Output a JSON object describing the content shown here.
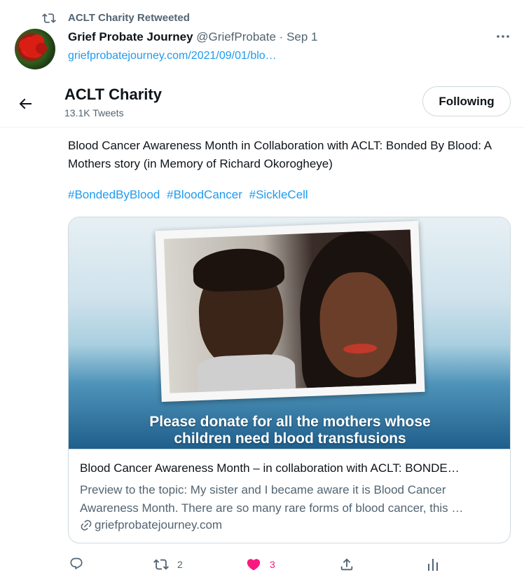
{
  "retweet_header": {
    "text": "ACLT Charity Retweeted"
  },
  "parent_tweet": {
    "author_name": "Grief Probate Journey",
    "handle": "@GriefProbate",
    "separator": "·",
    "date": "Sep 1",
    "link": "griefprobatejourney.com/2021/09/01/blo…"
  },
  "profile_header": {
    "name": "ACLT Charity",
    "tweet_count": "13.1K Tweets",
    "follow_button": "Following"
  },
  "tweet": {
    "text": "Blood Cancer Awareness Month in Collaboration with ACLT: Bonded By Blood: A Mothers story (in Memory of Richard Okorogheye)",
    "hashtags": [
      "#BondedByBlood",
      "#BloodCancer",
      "#SickleCell"
    ]
  },
  "card": {
    "image_caption_line1": "Please donate for all the mothers whose",
    "image_caption_line2": "children need blood transfusions",
    "title": "Blood Cancer Awareness Month – in collaboration with ACLT: BONDE…",
    "description_line1": "Preview to the topic: My sister and I became aware it is Blood Cancer",
    "description_line2": "Awareness Month. There are so many rare forms of blood cancer, this …",
    "domain": "griefprobatejourney.com"
  },
  "actions": {
    "reply_count": "",
    "retweet_count": "2",
    "like_count": "3"
  },
  "colors": {
    "link": "#1d9bf0",
    "secondary_text": "#536471",
    "like": "#f91880"
  },
  "icons": [
    "retweet-icon",
    "more-icon",
    "back-arrow-icon",
    "link-icon",
    "reply-icon",
    "like-heart-icon",
    "share-icon",
    "analytics-icon"
  ]
}
